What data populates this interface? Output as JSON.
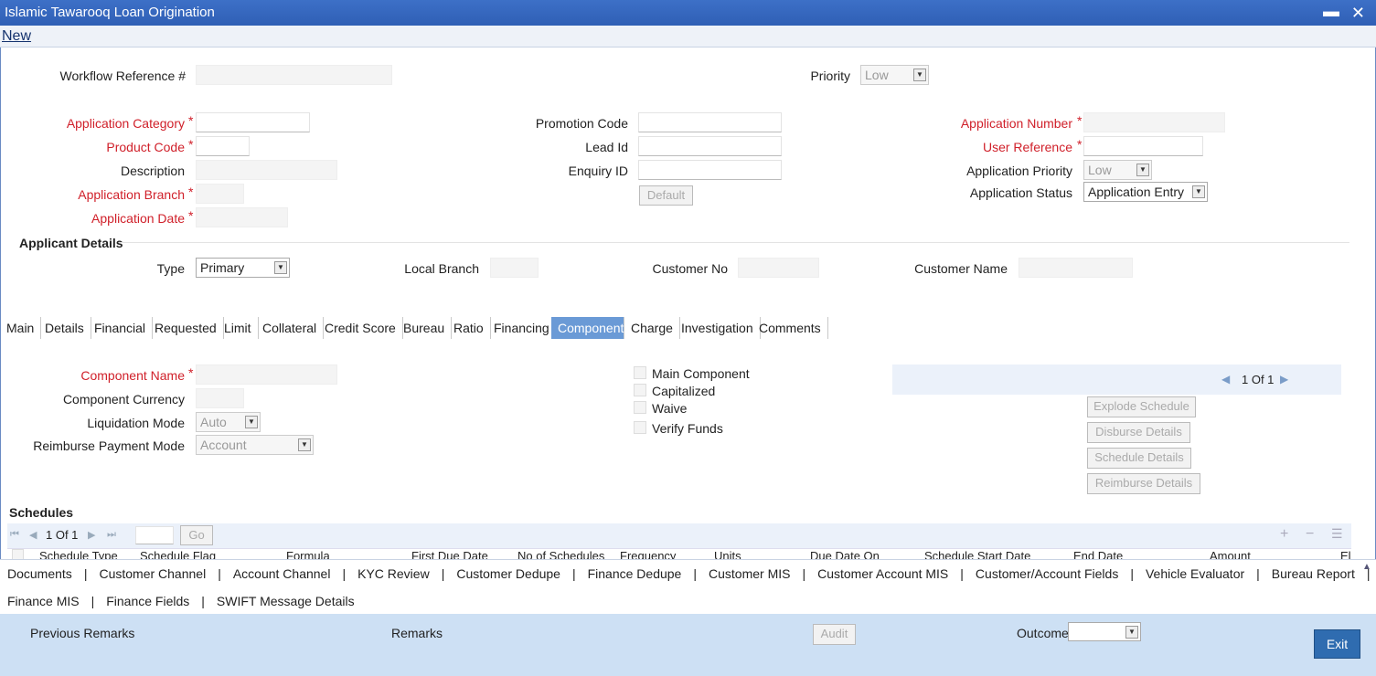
{
  "window": {
    "title": "Islamic Tawarooq Loan Origination",
    "minimize": "▬",
    "close": "✕"
  },
  "menu": {
    "new": "New"
  },
  "header": {
    "workflow_ref_label": "Workflow Reference #",
    "priority_label": "Priority",
    "priority_value": "Low"
  },
  "form": {
    "app_category_label": "Application Category",
    "product_code_label": "Product Code",
    "description_label": "Description",
    "app_branch_label": "Application Branch",
    "app_date_label": "Application Date",
    "promotion_code_label": "Promotion Code",
    "lead_id_label": "Lead Id",
    "enquiry_id_label": "Enquiry ID",
    "default_button": "Default",
    "app_number_label": "Application Number",
    "user_ref_label": "User Reference",
    "app_priority_label": "Application Priority",
    "app_priority_value": "Low",
    "app_status_label": "Application Status",
    "app_status_value": "Application Entry",
    "required_mark": "*"
  },
  "applicant": {
    "title": "Applicant Details",
    "type_label": "Type",
    "type_value": "Primary",
    "local_branch_label": "Local Branch",
    "customer_no_label": "Customer No",
    "customer_name_label": "Customer Name"
  },
  "tabs": [
    "Main",
    "Details",
    "Financial",
    "Requested",
    "Limit",
    "Collateral",
    "Credit Score",
    "Bureau",
    "Ratio",
    "Financing",
    "Component",
    "Charge",
    "Investigation",
    "Comments"
  ],
  "active_tab": "Component",
  "component": {
    "name_label": "Component Name",
    "currency_label": "Component Currency",
    "liquidation_label": "Liquidation Mode",
    "liquidation_value": "Auto",
    "reimburse_label": "Reimburse Payment Mode",
    "reimburse_value": "Account",
    "main_component": "Main Component",
    "capitalized": "Capitalized",
    "waive": "Waive",
    "verify_funds": "Verify Funds",
    "pager": "1 Of 1",
    "explode": "Explode Schedule",
    "disburse": "Disburse Details",
    "schedule": "Schedule Details",
    "reimburse_btn": "Reimburse Details"
  },
  "schedules": {
    "title": "Schedules",
    "pager": "1 Of 1",
    "go": "Go",
    "columns": [
      "Schedule Type",
      "Schedule Flag",
      "Formula",
      "First Due Date",
      "No of Schedules",
      "Frequency",
      "Units",
      "Due Date On",
      "Schedule Start Date",
      "End Date",
      "Amount",
      "El"
    ]
  },
  "links_row1": [
    "Documents",
    "Customer Channel",
    "Account Channel",
    "KYC Review",
    "Customer Dedupe",
    "Finance Dedupe",
    "Customer MIS",
    "Customer Account MIS",
    "Customer/Account Fields",
    "Vehicle Evaluator",
    "Bureau Report"
  ],
  "links_row2": [
    "Finance MIS",
    "Finance Fields",
    "SWIFT Message Details"
  ],
  "footer": {
    "previous_remarks": "Previous Remarks",
    "remarks": "Remarks",
    "audit": "Audit",
    "outcome": "Outcome",
    "exit": "Exit"
  }
}
